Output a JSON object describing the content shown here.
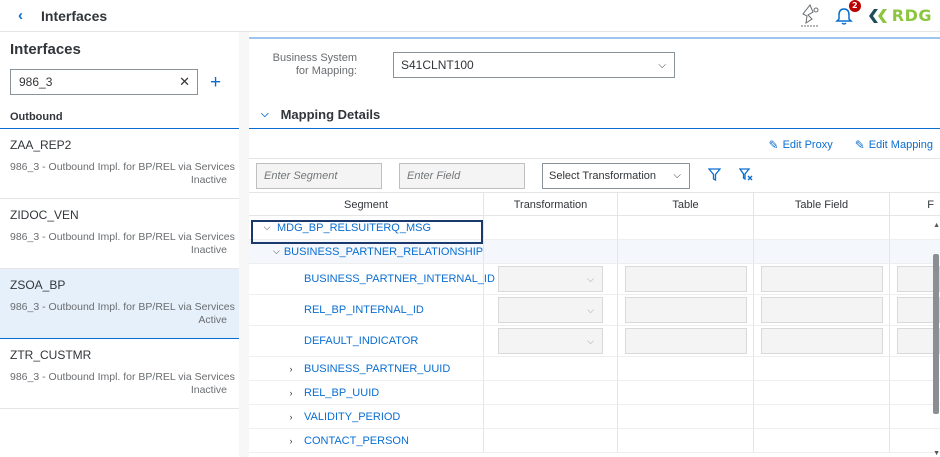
{
  "shell": {
    "back_icon": "chevron-left-icon",
    "title": "Interfaces",
    "notification_count": "2",
    "logo_text": "RDG"
  },
  "master": {
    "title": "Interfaces",
    "search_value": "986_3",
    "group_header": "Outbound",
    "items": [
      {
        "name": "ZAA_REP2",
        "description": "986_3 - Outbound Impl. for BP/REL via Services",
        "status": "Inactive"
      },
      {
        "name": "ZIDOC_VEN",
        "description": "986_3 - Outbound Impl. for BP/REL via Services",
        "status": "Inactive"
      },
      {
        "name": "ZSOA_BP",
        "description": "986_3 - Outbound Impl. for BP/REL via Services",
        "status": "Active"
      },
      {
        "name": "ZTR_CUSTMR",
        "description": "986_3 - Outbound Impl. for BP/REL via Services",
        "status": "Inactive"
      }
    ]
  },
  "detail": {
    "business_system_label": "Business System for Mapping:",
    "business_system_value": "S41CLNT100",
    "mapping_panel_title": "Mapping Details",
    "edit_proxy": "Edit Proxy",
    "edit_mapping": "Edit Mapping",
    "filter_segment_placeholder": "Enter Segment",
    "filter_field_placeholder": "Enter Field",
    "filter_transformation": "Select Transformation",
    "columns": [
      "Segment",
      "Transformation",
      "Table",
      "Table Field",
      "F"
    ],
    "rows": [
      {
        "label": "MDG_BP_RELSUITERQ_MSG",
        "toggle": "expanded"
      },
      {
        "label": "BUSINESS_PARTNER_RELATIONSHIP",
        "toggle": "expanded"
      },
      {
        "label": "BUSINESS_PARTNER_INTERNAL_ID",
        "toggle": "none"
      },
      {
        "label": "REL_BP_INTERNAL_ID",
        "toggle": "none"
      },
      {
        "label": "DEFAULT_INDICATOR",
        "toggle": "none"
      },
      {
        "label": "BUSINESS_PARTNER_UUID",
        "toggle": "collapsed"
      },
      {
        "label": "REL_BP_UUID",
        "toggle": "collapsed"
      },
      {
        "label": "VALIDITY_PERIOD",
        "toggle": "collapsed"
      },
      {
        "label": "CONTACT_PERSON",
        "toggle": "collapsed"
      }
    ]
  },
  "colors": {
    "accent": "#0a6ed1",
    "selected_bg": "#e5f0fa",
    "logo_green": "#8cc63f"
  }
}
